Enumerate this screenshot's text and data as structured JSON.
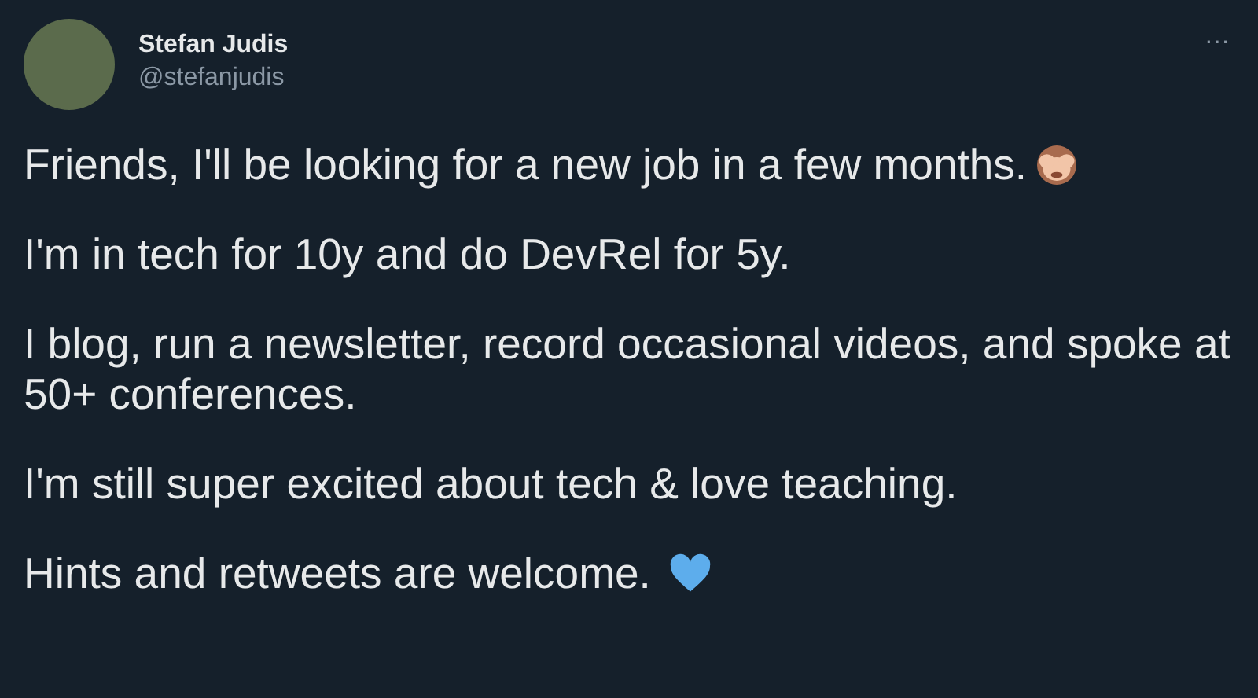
{
  "author": {
    "name": "Stefan Judis",
    "handle": "@stefanjudis"
  },
  "more_menu": {
    "label": "···"
  },
  "paragraphs": [
    {
      "text": "Friends, I'll be looking for a new job in a few months.",
      "kind": "emoji"
    },
    {
      "text": "I'm in tech for 10y and do DevRel for 5y.",
      "kind": "plain"
    },
    {
      "text": "I blog, run a newsletter, record occasional videos, and spoke at 50+ conferences.",
      "kind": "plain"
    },
    {
      "text": "I'm still super excited about tech & love teaching.",
      "kind": "plain"
    },
    {
      "text": "Hints and retweets are welcome.",
      "kind": "emoji"
    }
  ]
}
